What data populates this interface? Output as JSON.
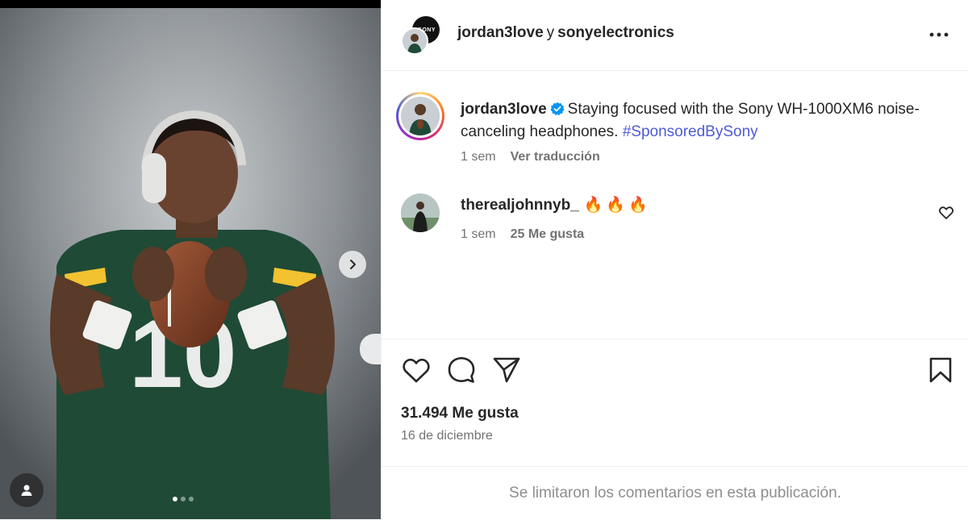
{
  "colors": {
    "text_primary": "#262626",
    "text_secondary": "#737373",
    "hashtag": "#4f5bd5",
    "verified": "#0095f6",
    "divider": "#efefef"
  },
  "media": {
    "slide_count": 3,
    "active_slide": 1,
    "next_icon": "chevron-right-icon",
    "tag_icon": "user-tag-icon"
  },
  "header": {
    "username": "jordan3love",
    "conjunction": "y",
    "collaborator": "sonyelectronics",
    "collaborator_logo": "SONY",
    "more_icon": "more-horizontal-icon"
  },
  "caption": {
    "username": "jordan3love",
    "verified_icon": "verified-badge-icon",
    "text": "Staying focused with the Sony WH-1000XM6 noise-canceling headphones.",
    "hashtag": "#SponsoredBySony",
    "time": "1 sem",
    "translate_label": "Ver traducción"
  },
  "comments": [
    {
      "username": "therealjohnnyb_",
      "text": "🔥🔥🔥",
      "time": "1 sem",
      "likes_label": "25 Me gusta",
      "like_icon": "heart-outline-icon"
    }
  ],
  "actions": {
    "like_icon": "heart-icon",
    "comment_icon": "comment-icon",
    "share_icon": "share-icon",
    "save_icon": "bookmark-icon"
  },
  "post": {
    "likes_label": "31.494 Me gusta",
    "date": "16 de diciembre",
    "comments_limited": "Se limitaron los comentarios en esta publicación."
  }
}
